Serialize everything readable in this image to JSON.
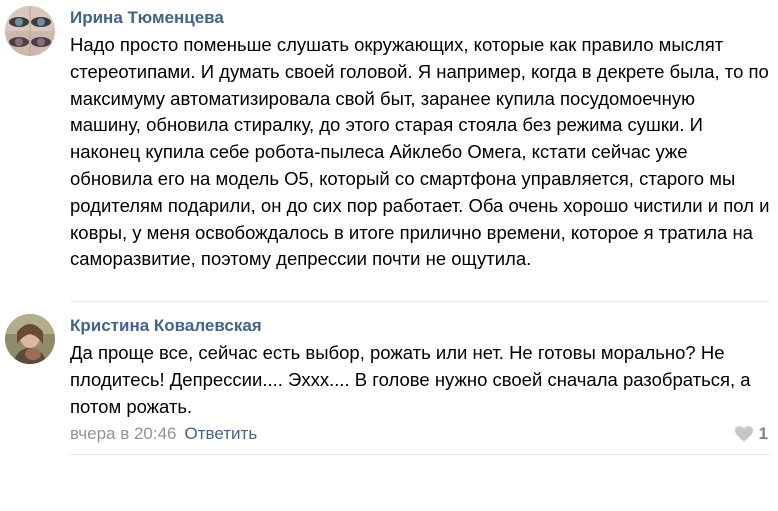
{
  "comments": [
    {
      "author": "Ирина Тюменцева",
      "avatar": "avatar-photo-eyes",
      "text": "Надо просто поменьше слушать окружающих, которые как правило мыслят стереотипами. И думать своей головой. Я например, когда в декрете была, то по максимуму автоматизировала свой быт, заранее купила посудомоечную машину, обновила стиралку, до этого старая стояла без режима сушки. И наконец купила себе робота-пылеса Айклебо Омега, кстати сейчас уже обновила его на модель О5, который со смартфона управляется, старого мы родителям подарили, он до сих пор работает. Оба очень хорошо чистили и пол и ковры, у меня освобождалось в итоге прилично времени, которое я тратила на саморазвитие, поэтому депрессии почти не ощутила."
    },
    {
      "author": "Кристина Ковалевская",
      "avatar": "avatar-photo-portrait",
      "text": "Да проще все, сейчас есть выбор, рожать или нет. Не готовы морально? Не плодитесь! Депрессии.... Эххх.... В голове нужно своей сначала разобраться, а потом рожать.",
      "date": "вчера в 20:46",
      "reply_label": "Ответить",
      "likes": "1",
      "like_icon": "heart-icon"
    }
  ],
  "colors": {
    "author": "#42648b",
    "meta": "#939393",
    "divider": "#e7e8ec",
    "like": "#828282"
  }
}
